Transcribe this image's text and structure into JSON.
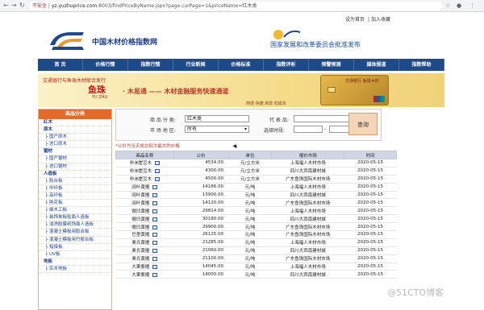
{
  "browser": {
    "security": "不安全",
    "host": "yz.yuzhuprice.com",
    "path": ":8003/findPriceByName.jspx?page.curPage=1&priceName=红木类"
  },
  "toplinks": [
    "设为首页",
    "加入收藏"
  ],
  "header": {
    "site_name": "中国木材价格指数网",
    "approve": "国家发展和改革委员会批准发布"
  },
  "nav": [
    "首  页",
    "价格行情",
    "指数行情",
    "行业新闻",
    "价格标准",
    "指数评析",
    "预警预测",
    "媒体报道",
    "指数帮助"
  ],
  "banner": {
    "small": "交通银行与鱼珠木材联合发行",
    "logo": "鱼珠",
    "logo_sub": "YU ZHU",
    "title": "· 木易通 —— 木材金融服务快速通道",
    "sub": "简便  快捷  高效  低成本",
    "card_name": "交通银行 鱼珠木材"
  },
  "sidebar": {
    "title": "商品分类",
    "items": [
      "红木",
      "原木",
      "├ 国产原木",
      "├ 进口原木",
      "锯材",
      "├ 国产锯材",
      "├ 进口锯材",
      "人造板",
      "├ 胶合板",
      "├ 中纤板",
      "├ 高纤板",
      "├ 刨花板",
      "├ 细木工板",
      "├ 装饰单板贴面人造板",
      "├ 浸渍胶膜纸饰面人造板",
      "├ 混凝土模板用胶合板",
      "├ 混凝土模板用竹胶合板",
      "├ 指接板",
      "├ UV板",
      "地板",
      "├ 实木地板"
    ]
  },
  "search": {
    "name_label": "商 品 分 类:",
    "name_value": "红木类",
    "code_label": "代 表 品:",
    "code_value": "",
    "market_label": "市 场 地 区:",
    "market_value": "所有",
    "date_label": "选择时段:",
    "date_sep": "-",
    "query_button": "查询"
  },
  "note": "*公价为当天成交批次最大的价格",
  "table": {
    "headers": [
      "商品名称",
      "公价",
      "单位",
      "报价市场",
      "时间"
    ],
    "rows": [
      [
        "非洲崖豆木",
        "4534.00",
        "元/立方米",
        "上海福人木材市场",
        "2020-05-15"
      ],
      [
        "非洲崖豆木",
        "4300.00",
        "元/立方米",
        "四川大西南建材城",
        "2020-05-15"
      ],
      [
        "非洲崖豆木",
        "4500.00",
        "元/立方米",
        "广东鱼珠国际木材市场",
        "2020-05-15"
      ],
      [
        "阔叶黄檀",
        "14186.00",
        "元/吨",
        "上海福人木材市场",
        "2020-05-15"
      ],
      [
        "阔叶黄檀",
        "13900.00",
        "元/吨",
        "四川大西南建材城",
        "2020-05-15"
      ],
      [
        "阔叶黄檀",
        "14120.00",
        "元/吨",
        "广东鱼珠国际木材市场",
        "2020-05-15"
      ],
      [
        "微凹黄檀",
        "29814.00",
        "元/吨",
        "上海福人木材市场",
        "2020-05-15"
      ],
      [
        "微凹黄檀",
        "30180.00",
        "元/吨",
        "四川大西南建材城",
        "2020-05-15"
      ],
      [
        "微凹黄檀",
        "29900.00",
        "元/吨",
        "广东鱼珠国际木材市场",
        "2020-05-15"
      ],
      [
        "巴里黄檀",
        "26125.00",
        "元/吨",
        "广东鱼珠国际木材市场",
        "2020-05-15"
      ],
      [
        "奥氏黄檀",
        "21285.00",
        "元/吨",
        "上海福人木材市场",
        "2020-05-15"
      ],
      [
        "奥氏黄檀",
        "21060.00",
        "元/吨",
        "四川大西南建材城",
        "2020-05-15"
      ],
      [
        "奥氏黄檀",
        "21100.00",
        "元/吨",
        "广东鱼珠国际木材市场",
        "2020-05-15"
      ],
      [
        "大果紫檀",
        "14045.00",
        "元/吨",
        "上海福人木材市场",
        "2020-05-15"
      ],
      [
        "大果紫檀",
        "14000.00",
        "元/吨",
        "四川大西南建材城",
        "2020-05-15"
      ]
    ]
  },
  "watermark": "@51CTO博客"
}
